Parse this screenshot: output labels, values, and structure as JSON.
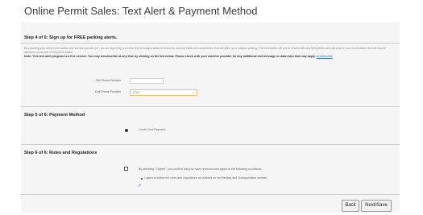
{
  "page_title": "Online Permit Sales: Text Alert & Payment Method",
  "step4": {
    "heading": "Step 4 of 6: Sign up for FREE parking alerts.",
    "paragraph": "By providing your cell phone number and service provider (i.e., you are agreeing to receive text messages about lot closures, unusual traffic and construction that will affect your campus parking. The information will not be shared with any third parties and will only be used in situations that will require attention on the part of the permit holder.",
    "note": "Note: This text alert program is a free service. You may unsubscribe at any time by clicking on the link below. Please check with your wireless provider for any additional text message or data rates that may apply.",
    "unsubscribe_link": "Unsubscribe",
    "cell_phone_label": "Cell Phone Number",
    "cell_phone_value": "",
    "provider_label": "Cell Phone Provider",
    "provider_value": "AT&T"
  },
  "step5": {
    "heading": "Step 5 of 6: Payment Method",
    "option_label": "Credit Card Payment"
  },
  "step6": {
    "heading": "Step 6 of 6: Rules and Regulations",
    "agree_text": "By selecting \"I Agree\", you confirm that you have reviewed and agree to the following conditions:",
    "bullet_text": "I agree to follow the rules and regulations as outlined on the Parking and Transportation website."
  },
  "buttons": {
    "back": "Back",
    "next_save": "Next/Save"
  }
}
